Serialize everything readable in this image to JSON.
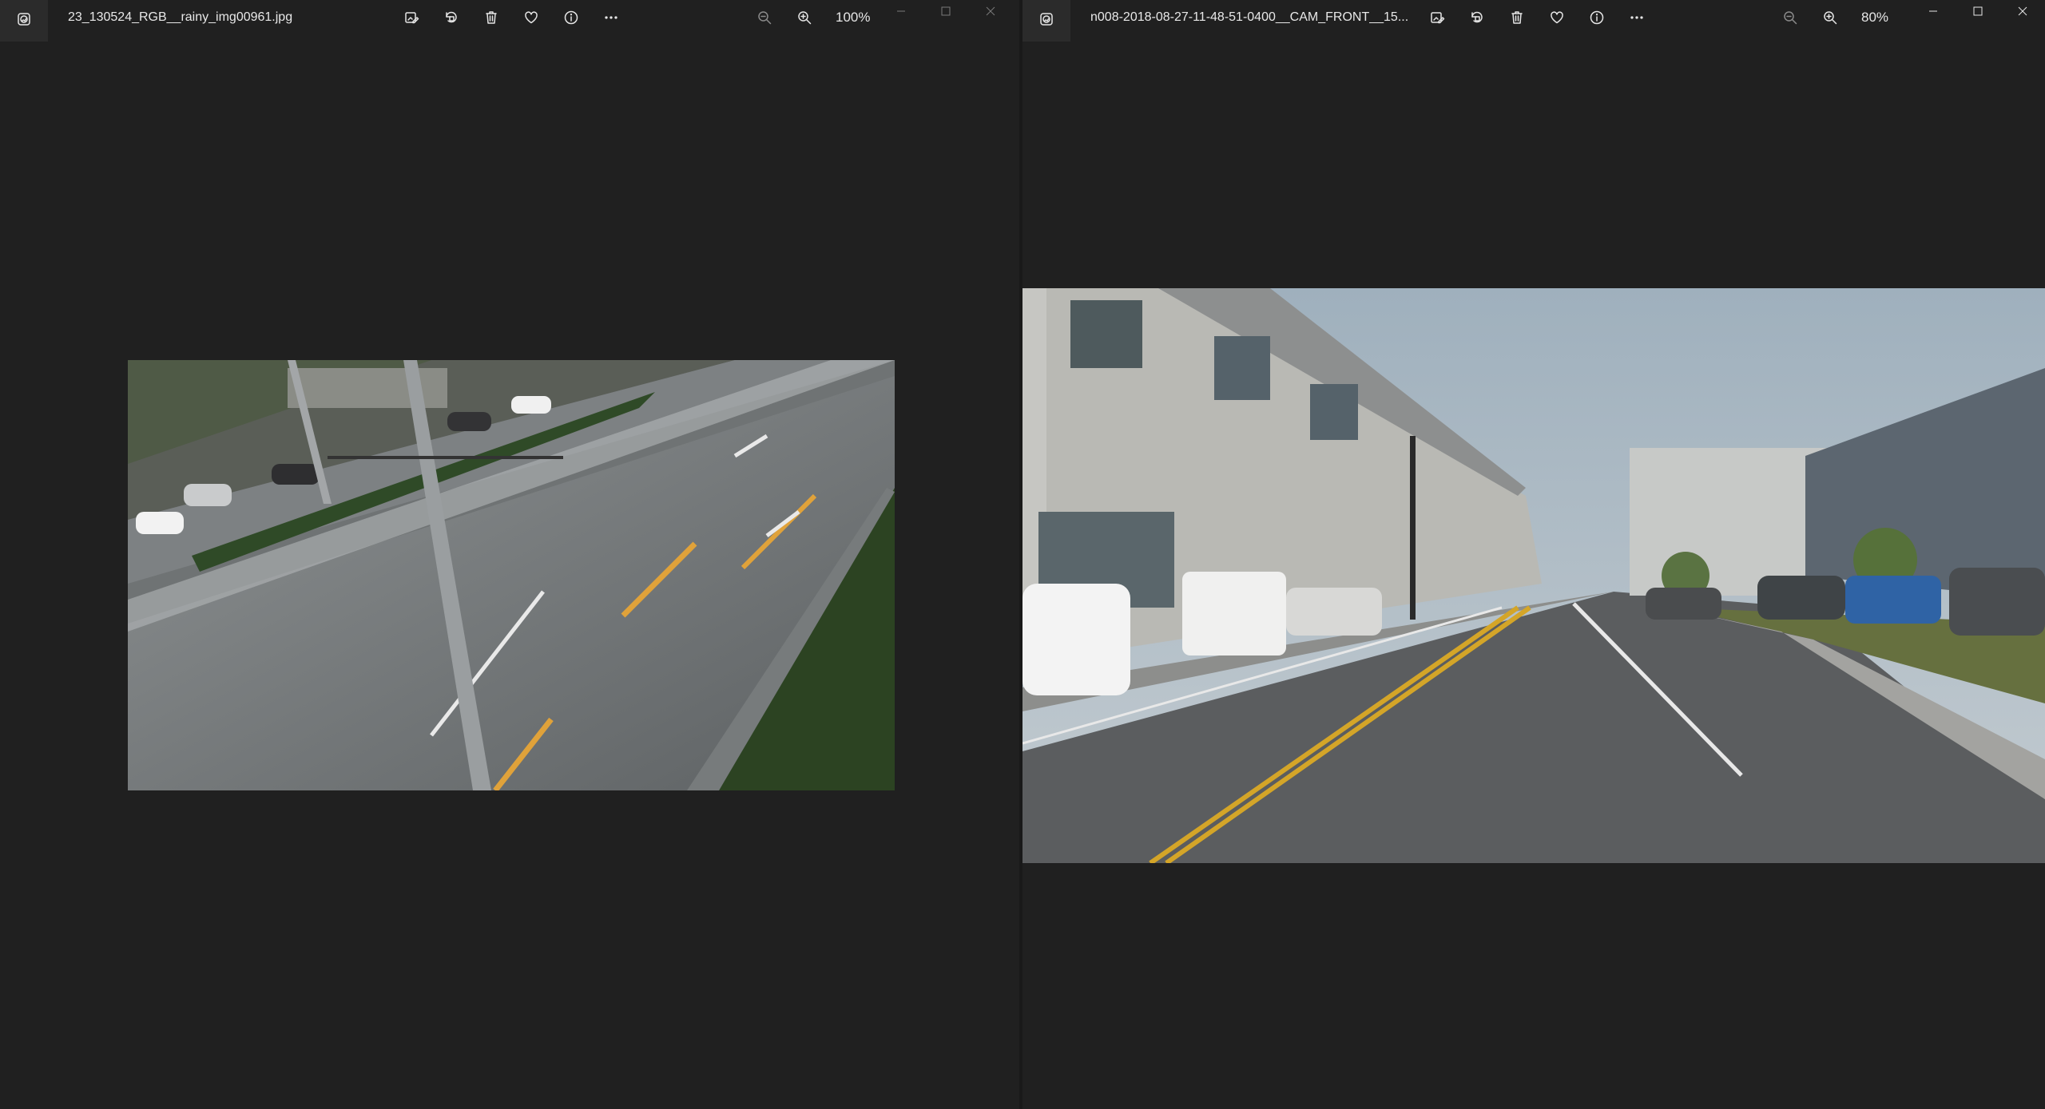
{
  "left": {
    "filename": "23_130524_RGB__rainy_img00961.jpg",
    "zoom": "100%",
    "icons": [
      "photos-app-icon",
      "edit-image-icon",
      "rotate-icon",
      "delete-icon",
      "favorite-heart-icon",
      "info-icon",
      "more-options-icon",
      "zoom-out-icon",
      "zoom-in-icon",
      "minimize-icon",
      "maximize-icon",
      "close-icon"
    ]
  },
  "right": {
    "filename": "n008-2018-08-27-11-48-51-0400__CAM_FRONT__15...",
    "zoom": "80%",
    "icons": [
      "photos-app-icon",
      "edit-image-icon",
      "rotate-icon",
      "delete-icon",
      "favorite-heart-icon",
      "info-icon",
      "more-options-icon",
      "zoom-out-icon",
      "zoom-in-icon",
      "minimize-icon",
      "maximize-icon",
      "close-icon"
    ]
  },
  "colors": {
    "background": "#202020",
    "titlebar_highlight": "#2b2b2b",
    "text": "#e6e6e6"
  }
}
